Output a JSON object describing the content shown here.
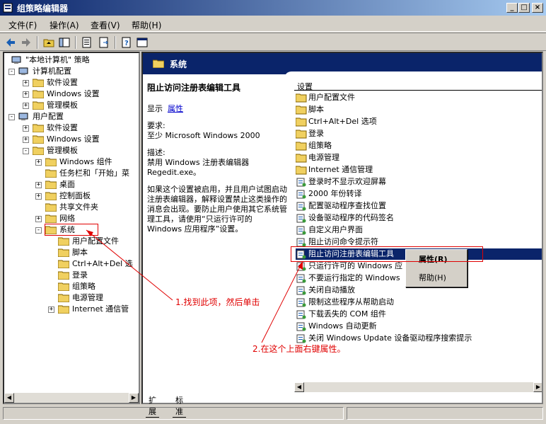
{
  "window": {
    "title": "组策略编辑器"
  },
  "menus": [
    "文件(F)",
    "操作(A)",
    "查看(V)",
    "帮助(H)"
  ],
  "tree": [
    {
      "label": "\"本地计算机\" 策略",
      "level": 0,
      "exp": ""
    },
    {
      "label": "计算机配置",
      "level": 1,
      "exp": "-"
    },
    {
      "label": "软件设置",
      "level": 2,
      "exp": "+"
    },
    {
      "label": "Windows 设置",
      "level": 2,
      "exp": "+"
    },
    {
      "label": "管理模板",
      "level": 2,
      "exp": "+"
    },
    {
      "label": "用户配置",
      "level": 1,
      "exp": "-"
    },
    {
      "label": "软件设置",
      "level": 2,
      "exp": "+"
    },
    {
      "label": "Windows 设置",
      "level": 2,
      "exp": "+"
    },
    {
      "label": "管理模板",
      "level": 2,
      "exp": "-"
    },
    {
      "label": "Windows 组件",
      "level": 3,
      "exp": "+"
    },
    {
      "label": "任务栏和「开始」菜",
      "level": 3,
      "exp": ""
    },
    {
      "label": "桌面",
      "level": 3,
      "exp": "+"
    },
    {
      "label": "控制面板",
      "level": 3,
      "exp": "+"
    },
    {
      "label": "共享文件夹",
      "level": 3,
      "exp": ""
    },
    {
      "label": "网络",
      "level": 3,
      "exp": "+"
    },
    {
      "label": "系统",
      "level": 3,
      "exp": "-"
    },
    {
      "label": "用户配置文件",
      "level": 4,
      "exp": ""
    },
    {
      "label": "脚本",
      "level": 4,
      "exp": ""
    },
    {
      "label": "Ctrl+Alt+Del 选",
      "level": 4,
      "exp": ""
    },
    {
      "label": "登录",
      "level": 4,
      "exp": ""
    },
    {
      "label": "组策略",
      "level": 4,
      "exp": ""
    },
    {
      "label": "电源管理",
      "level": 4,
      "exp": ""
    },
    {
      "label": "Internet 通信管",
      "level": 4,
      "exp": "+"
    }
  ],
  "right": {
    "header_title": "系统",
    "desc_title": "阻止访问注册表编辑工具",
    "display_label": "显示",
    "properties_link": "属性",
    "req_label": "要求:",
    "req_text": "至少 Microsoft Windows 2000",
    "desc_label": "描述:",
    "desc_text": "禁用 Windows 注册表编辑器 Regedit.exe。",
    "desc_more": "如果这个设置被启用，并且用户试图启动注册表编辑器，解释设置禁止这类操作的消息会出现。要防止用户使用其它系统管理工具，请使用“只运行许可的 Windows 应用程序”设置。",
    "list_header": "设置",
    "items": [
      {
        "label": "用户配置文件",
        "kind": "folder"
      },
      {
        "label": "脚本",
        "kind": "folder"
      },
      {
        "label": "Ctrl+Alt+Del 选项",
        "kind": "folder"
      },
      {
        "label": "登录",
        "kind": "folder"
      },
      {
        "label": "组策略",
        "kind": "folder"
      },
      {
        "label": "电源管理",
        "kind": "folder"
      },
      {
        "label": "Internet 通信管理",
        "kind": "folder"
      },
      {
        "label": "登录时不显示欢迎屏幕",
        "kind": "setting"
      },
      {
        "label": "2000 年份转译",
        "kind": "setting"
      },
      {
        "label": "配置驱动程序查找位置",
        "kind": "setting"
      },
      {
        "label": "设备驱动程序的代码签名",
        "kind": "setting"
      },
      {
        "label": "自定义用户界面",
        "kind": "setting"
      },
      {
        "label": "阻止访问命令提示符",
        "kind": "setting"
      },
      {
        "label": "阻止访问注册表编辑工具",
        "kind": "setting"
      },
      {
        "label": "只运行许可的 Windows 应",
        "kind": "setting"
      },
      {
        "label": "不要运行指定的 Windows",
        "kind": "setting"
      },
      {
        "label": "关闭自动播放",
        "kind": "setting"
      },
      {
        "label": "限制这些程序从帮助启动",
        "kind": "setting"
      },
      {
        "label": "下载丢失的 COM 组件",
        "kind": "setting"
      },
      {
        "label": "Windows 自动更新",
        "kind": "setting"
      },
      {
        "label": "关闭 Windows Update 设备驱动程序搜索提示",
        "kind": "setting"
      }
    ]
  },
  "tabs": [
    "扩展",
    "标准"
  ],
  "context_menu": [
    "属性(R)",
    "帮助(H)"
  ],
  "annotations": {
    "step1": "1.找到此项，然后单击",
    "step2": "2.在这个上面右键属性。"
  },
  "colors": {
    "title": "#0a246a",
    "annotation": "#e00000"
  }
}
